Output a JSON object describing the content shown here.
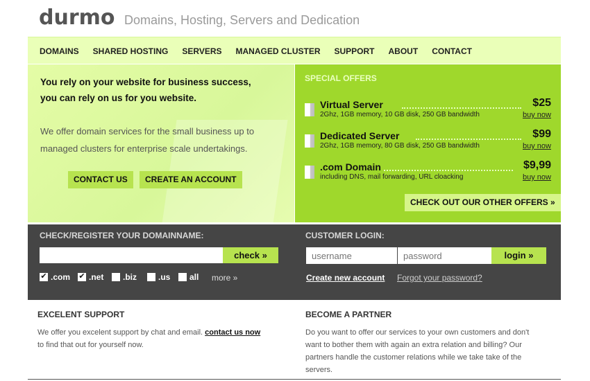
{
  "header": {
    "logo": "durmo",
    "tagline": "Domains, Hosting, Servers and Dedication"
  },
  "nav": {
    "items": [
      "DOMAINS",
      "SHARED HOSTING",
      "SERVERS",
      "MANAGED CLUSTER",
      "SUPPORT",
      "ABOUT",
      "CONTACT"
    ]
  },
  "hero": {
    "lead_line1": "You rely on your website for business success,",
    "lead_line2": "you can rely on us for you website.",
    "desc_line1": "We offer domain services for the small business up to",
    "desc_line2": "managed clusters for enterprise scale undertakings.",
    "contact_button": "CONTACT US",
    "create_button": "CREATE AN ACCOUNT"
  },
  "offers": {
    "title": "SPECIAL OFFERS",
    "items": [
      {
        "name": "Virtual Server",
        "spec": "2Ghz, 1GB memory, 10 GB disk, 250 GB bandwidth",
        "price": "$25",
        "buy": "buy now"
      },
      {
        "name": "Dedicated Server",
        "spec": "2Ghz, 1GB memory, 80 GB disk, 250 GB bandwidth",
        "price": "$99",
        "buy": "buy now"
      },
      {
        "name": ".com Domain",
        "spec": "including DNS, mail forwarding, URL cloacking",
        "price": "$9,99",
        "buy": "buy now"
      }
    ],
    "more_button": "CHECK OUT OUR OTHER OFFERS »"
  },
  "domain_check": {
    "label": "CHECK/REGISTER YOUR DOMAINNAME:",
    "input_value": "",
    "button": "check »",
    "tlds": [
      {
        "label": ".com",
        "checked": true
      },
      {
        "label": ".net",
        "checked": true
      },
      {
        "label": ".biz",
        "checked": false
      },
      {
        "label": ".us",
        "checked": false
      },
      {
        "label": "all",
        "checked": false
      }
    ],
    "more": "more »"
  },
  "login": {
    "label": "CUSTOMER LOGIN:",
    "username_placeholder": "username",
    "password_placeholder": "password",
    "button": "login »",
    "create_link": "Create new account",
    "forgot_link": "Forgot your password?"
  },
  "support": {
    "title": "EXCELENT SUPPORT",
    "text1": "We offer you excelent support by chat and email.",
    "link": "contact us now",
    "text2": "to find that out for yourself now."
  },
  "partner": {
    "title": "BECOME A PARTNER",
    "line1": "Do you want to offer our services to your own customers and don't",
    "line2": "want to bother them with again an extra relation and billing?  Our",
    "line3": "partners handle the customer relations while we take take of the",
    "line4": "servers."
  },
  "colors": {
    "accent_green": "#b7e34f",
    "offers_green": "#9fd82c",
    "light_green": "#eaffb8",
    "dark_band": "#454545"
  }
}
